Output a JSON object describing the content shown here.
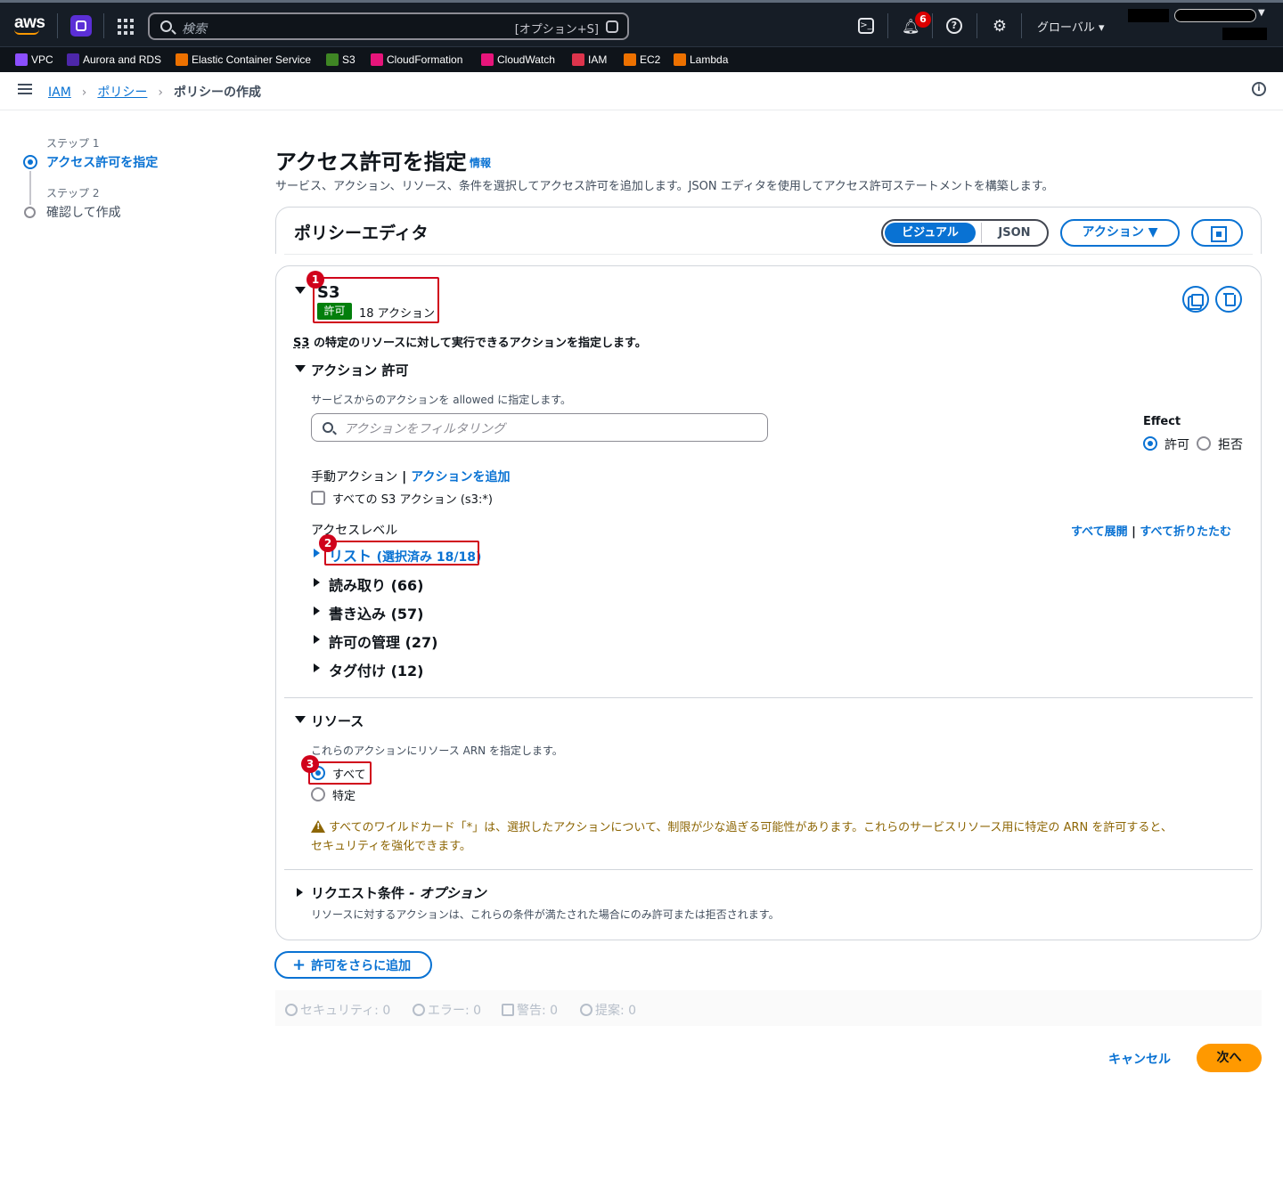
{
  "topbar": {
    "logo": "aws",
    "search_placeholder": "検索",
    "search_shortcut": "[オプション+S]",
    "notification_count": "6",
    "region": "グローバル ▾",
    "icons": [
      "unified-studio-icon",
      "apps-grid-icon",
      "search-icon",
      "cloudshell-icon",
      "bell-icon",
      "help-icon",
      "gear-icon"
    ]
  },
  "favorites": [
    {
      "label": "VPC",
      "color": "#8c4fff"
    },
    {
      "label": "Aurora and RDS",
      "color": "#4d27aa"
    },
    {
      "label": "Elastic Container Service",
      "color": "#ed7100"
    },
    {
      "label": "S3",
      "color": "#3f8624"
    },
    {
      "label": "CloudFormation",
      "color": "#e7157b"
    },
    {
      "label": "CloudWatch",
      "color": "#e7157b"
    },
    {
      "label": "IAM",
      "color": "#dd344c"
    },
    {
      "label": "EC2",
      "color": "#ed7100"
    },
    {
      "label": "Lambda",
      "color": "#ed7100"
    }
  ],
  "breadcrumb": {
    "items": [
      "IAM",
      "ポリシー"
    ],
    "current": "ポリシーの作成"
  },
  "steps": [
    {
      "label": "ステップ 1",
      "title": "アクセス許可を指定",
      "active": true
    },
    {
      "label": "ステップ 2",
      "title": "確認して作成",
      "active": false
    }
  ],
  "page": {
    "title": "アクセス許可を指定",
    "info": "情報",
    "description": "サービス、アクション、リソース、条件を選択してアクセス許可を追加します。JSON エディタを使用してアクセス許可ステートメントを構築します。"
  },
  "editor": {
    "title": "ポリシーエディタ",
    "visual_label": "ビジュアル",
    "json_label": "JSON",
    "actions_label": "アクション ▼"
  },
  "statement": {
    "service": "S3",
    "effect_badge": "許可",
    "action_count": "18 アクション",
    "service_abbr": "S3",
    "description": " の特定のリソースに対して実行できるアクションを指定します。",
    "actions_section": "アクション 許可",
    "actions_help": "サービスからのアクションを allowed に指定します。",
    "filter_placeholder": "アクションをフィルタリング",
    "effect_label": "Effect",
    "effect_allow": "許可",
    "effect_deny": "拒否",
    "manual_actions": "手動アクション",
    "manual_sep": " | ",
    "add_actions": "アクションを追加",
    "all_actions": "すべての S3 アクション (s3:*)",
    "access_level": "アクセスレベル",
    "expand_all": "すべて展開",
    "level_sep": " | ",
    "collapse_all": "すべて折りたたむ",
    "levels": [
      {
        "name": "リスト",
        "count": "(選択済み 18/18)"
      },
      {
        "name": "読み取り",
        "count": "(66)"
      },
      {
        "name": "書き込み",
        "count": "(57)"
      },
      {
        "name": "許可の管理",
        "count": "(27)"
      },
      {
        "name": "タグ付け",
        "count": "(12)"
      }
    ],
    "resources_section": "リソース",
    "resources_help": "これらのアクションにリソース ARN を指定します。",
    "res_all": "すべて",
    "res_specific": "特定",
    "warning_line1": "すべてのワイルドカード「*」は、選択したアクションについて、制限が少な過ぎる可能性があります。これらのサービスリソース用に特定の ARN を許可すると、",
    "warning_line2": "セキュリティを強化できます。",
    "conditions_section": "リクエスト条件",
    "conditions_optional": " - オプション",
    "conditions_help": "リソースに対するアクションは、これらの条件が満たされた場合にのみ許可または拒否されます。"
  },
  "annotations": [
    "1",
    "2",
    "3"
  ],
  "add_permissions": "許可をさらに追加",
  "validation": [
    {
      "label": "セキュリティ: 0",
      "icon": "shield-icon"
    },
    {
      "label": "エラー: 0",
      "icon": "error-icon"
    },
    {
      "label": "警告: 0",
      "icon": "warning-icon"
    },
    {
      "label": "提案: 0",
      "icon": "lightbulb-icon"
    }
  ],
  "footer": {
    "cancel": "キャンセル",
    "next": "次へ"
  },
  "colors": {
    "primary": "#0972d3",
    "allow": "#037f0c",
    "annotation": "#d0021b",
    "next": "#ff9900",
    "warning": "#8d6605"
  }
}
